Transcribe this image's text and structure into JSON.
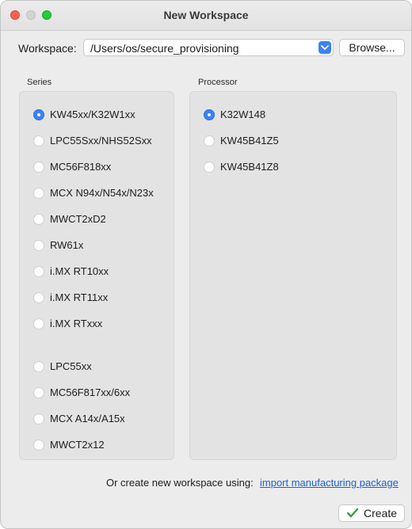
{
  "window": {
    "title": "New Workspace"
  },
  "workspace": {
    "label": "Workspace:",
    "path": "/Users/os/secure_provisioning",
    "browse_label": "Browse..."
  },
  "series": {
    "label": "Series",
    "items": [
      {
        "label": "KW45xx/K32W1xx",
        "selected": true
      },
      {
        "label": "LPC55Sxx/NHS52Sxx",
        "selected": false
      },
      {
        "label": "MC56F818xx",
        "selected": false
      },
      {
        "label": "MCX N94x/N54x/N23x",
        "selected": false
      },
      {
        "label": "MWCT2xD2",
        "selected": false
      },
      {
        "label": "RW61x",
        "selected": false
      },
      {
        "label": "i.MX RT10xx",
        "selected": false
      },
      {
        "label": "i.MX RT11xx",
        "selected": false
      },
      {
        "label": "i.MX RTxxx",
        "selected": false
      },
      {
        "label": "LPC55xx",
        "selected": false
      },
      {
        "label": "MC56F817xx/6xx",
        "selected": false
      },
      {
        "label": "MCX A14x/A15x",
        "selected": false
      },
      {
        "label": "MWCT2x12",
        "selected": false
      }
    ]
  },
  "processor": {
    "label": "Processor",
    "items": [
      {
        "label": "K32W148",
        "selected": true
      },
      {
        "label": "KW45B41Z5",
        "selected": false
      },
      {
        "label": "KW45B41Z8",
        "selected": false
      }
    ]
  },
  "footer": {
    "text": "Or create new workspace using:",
    "link": "import manufacturing package",
    "create_label": "Create"
  },
  "colors": {
    "accent": "#3a82f6",
    "link": "#1a5fd6",
    "check": "#2fa043"
  }
}
